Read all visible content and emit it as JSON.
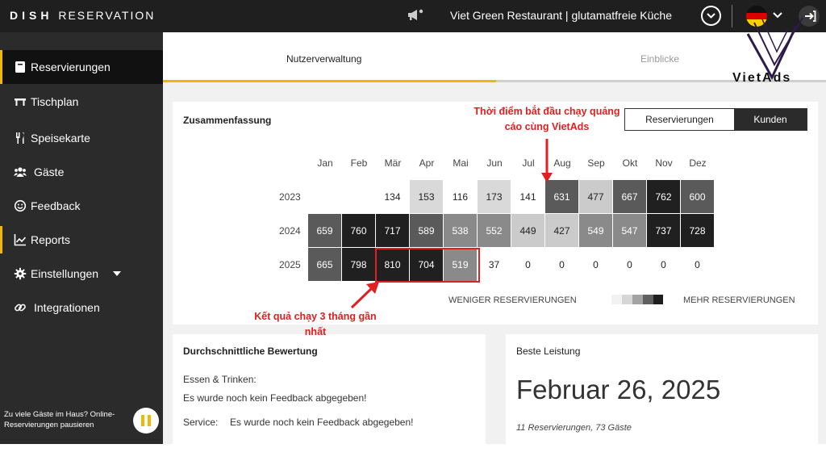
{
  "app": {
    "brand_bold": "DISH",
    "brand_rest": "RESERVATION"
  },
  "header": {
    "restaurant_name": "Viet Green Restaurant | glutamatfreie Küche",
    "icons": [
      "megaphone-icon",
      "chevron-down-icon",
      "flag-de-icon",
      "logout-icon"
    ]
  },
  "sidebar": {
    "items": [
      {
        "label": "Reservierungen",
        "icon": "book-icon"
      },
      {
        "label": "Tischplan",
        "icon": "table-icon"
      },
      {
        "label": "Speisekarte",
        "icon": "cutlery-icon"
      },
      {
        "label": "Gäste",
        "icon": "users-icon"
      },
      {
        "label": "Feedback",
        "icon": "smiley-icon"
      },
      {
        "label": "Reports",
        "icon": "chart-icon"
      },
      {
        "label": "Einstellungen",
        "icon": "gear-icon"
      },
      {
        "label": "Integrationen",
        "icon": "link-icon"
      }
    ],
    "pause_text": "Zu viele Gäste im Haus? Online-Reservierungen pausieren"
  },
  "tabs": [
    {
      "label": "Nutzerverwaltung"
    },
    {
      "label": "Einblicke"
    }
  ],
  "summary": {
    "title": "Zusammenfassung",
    "toggle": [
      "Reservierungen",
      "Kunden"
    ],
    "months": [
      "Jan",
      "Feb",
      "Mär",
      "Apr",
      "Mai",
      "Jun",
      "Jul",
      "Aug",
      "Sep",
      "Okt",
      "Nov",
      "Dez"
    ],
    "rows": [
      {
        "year": "2023",
        "values": [
          null,
          null,
          134,
          153,
          116,
          173,
          141,
          631,
          477,
          667,
          762,
          600
        ]
      },
      {
        "year": "2024",
        "values": [
          659,
          760,
          717,
          589,
          538,
          552,
          449,
          427,
          549,
          547,
          737,
          728
        ]
      },
      {
        "year": "2025",
        "values": [
          665,
          798,
          810,
          704,
          519,
          37,
          0,
          0,
          0,
          0,
          0,
          0
        ]
      }
    ],
    "legend_low": "WENIGER RESERVIERUNGEN",
    "legend_high": "MEHR RESERVIERUNGEN"
  },
  "annotations": {
    "start": "Thời điểm bắt đầu chạy quảng cáo cùng VietAds",
    "result": "Kết quả chạy 3 tháng gần nhất"
  },
  "rating": {
    "title": "Durchschnittliche Bewertung",
    "food_label": "Essen & Trinken:",
    "food_value": "Es wurde noch kein Feedback abgegeben!",
    "service_label": "Service:",
    "service_value": "Es wurde noch kein Feedback abgegeben!"
  },
  "best": {
    "title": "Beste Leistung",
    "date": "Februar 26, 2025",
    "detail": "11 Reservierungen, 73 Gäste"
  },
  "watermark": {
    "text": "VietAds"
  },
  "colors": {
    "accent": "#f2b705",
    "annotation": "#e02020",
    "dark": "#2b2b2b"
  }
}
